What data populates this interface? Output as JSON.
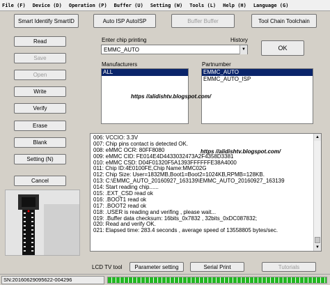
{
  "menu": [
    "File (F)",
    "Device (D)",
    "Operation (P)",
    "Buffer (U)",
    "Setting (W)",
    "Tools (L)",
    "Help (H)",
    "Language (G)"
  ],
  "top_buttons": {
    "smart_identify": "Smart Identify SmartID",
    "auto_isp": "Auto ISP AutoISP",
    "buffer": "Buffer Buffer",
    "tool_chain": "Tool Chain Toolchain"
  },
  "left_buttons": {
    "read": "Read",
    "save": "Save",
    "open": "Open",
    "write": "Write",
    "verify": "Verify",
    "erase": "Erase",
    "blank": "Blank",
    "setting": "Setting (N)",
    "cancel": "Cancel"
  },
  "chip_printing": {
    "label": "Enter chip printing",
    "value": "EMMC_AUTO",
    "history_label": "History",
    "ok": "OK"
  },
  "manufacturers": {
    "label": "Manufacturers",
    "items": [
      "ALL"
    ]
  },
  "partnumber": {
    "label": "Partnumber",
    "items": [
      "EMMC_AUTO",
      "EMMC_AUTO_ISP"
    ]
  },
  "watermark": "https //alidishtv.blogspot.com/",
  "log_lines": [
    "006:  VCCIO: 3.3V",
    "007:  Chip pins contact is detected OK.",
    "008:  eMMC OCR: 80FF8080",
    "009:  eMMC CID:  FE014E4D4433032473A2F4358D3381",
    "010:  eMMC CSD: D04F01320F5A1393FFFFFFE38A4000",
    "011:  Chip ID:4E0100FE,Chip Name:MMC02G",
    "012:  Chip Size: User=1832MB,Boot1=Boot2=1024KB,RPMB=128KB.",
    "013:  C:\\EMMC_AUTO_20160927_163139\\EMMC_AUTO_20160927_163139",
    "014:  Start reading chip......",
    "015:  .EXT_CSD read ok",
    "016:  .BOOT1 read ok",
    "017:  .BOOT2 read ok",
    "018:  .USER  is reading and verifing , please wait...",
    "019:  .Buffer data checksum: 16bits_0x7832 , 32bits_0xDC087832;",
    "020:  Read and verify OK.",
    "021:  Elapsed time: 283.4 seconds , average speed of 13558805 bytes/sec."
  ],
  "bottom": {
    "lcd_label": "LCD TV tool",
    "parameter_setting": "Parameter setting",
    "serial_print": "Serial Print",
    "tutorials": "Tutorials"
  },
  "status": {
    "sn": "SN:20160629095622-004296",
    "progress": 1.0
  },
  "colors": {
    "selection": "#0a246a",
    "progress": "#22b822",
    "window_bg": "#d4d0c8"
  }
}
